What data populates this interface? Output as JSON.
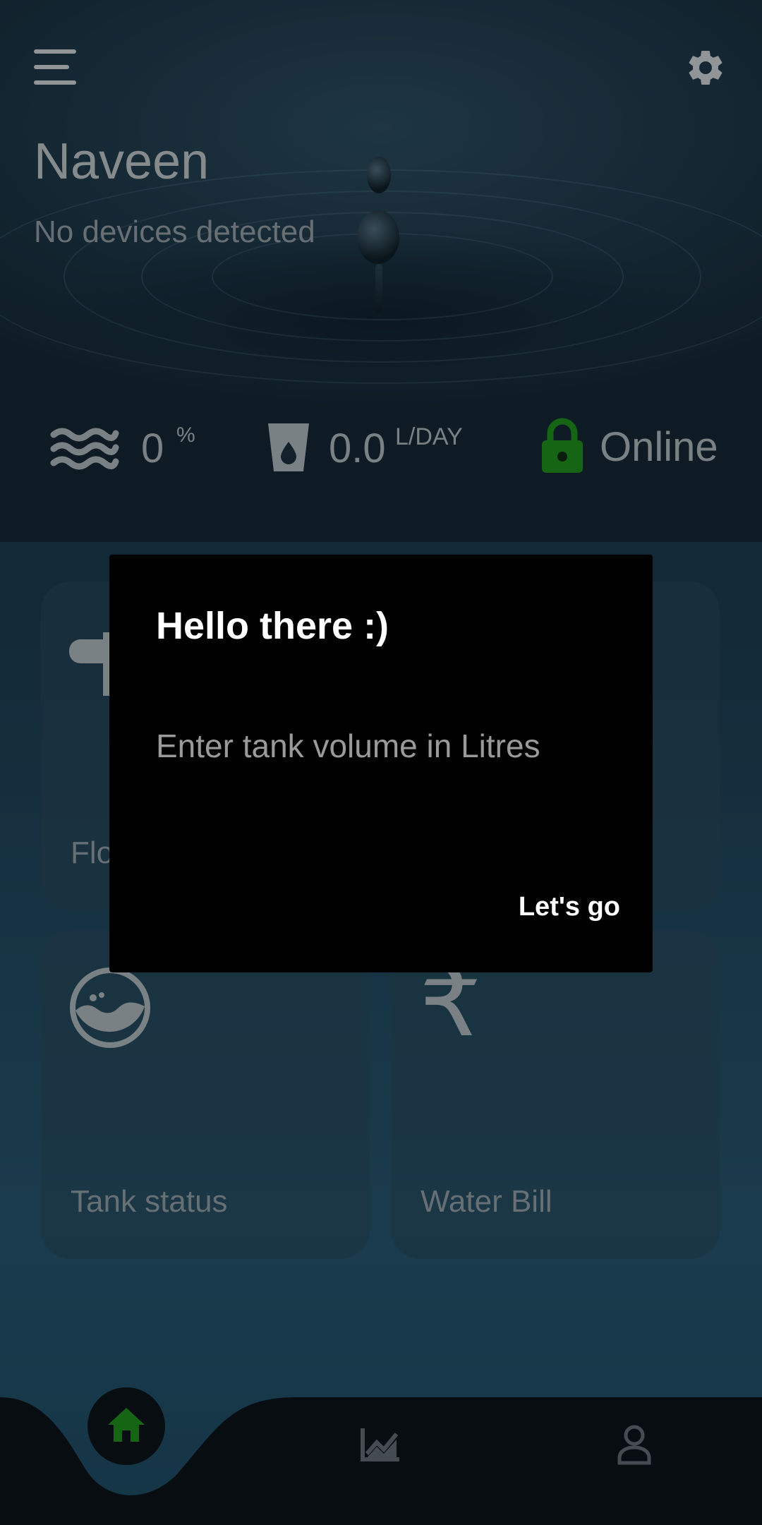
{
  "header": {
    "user_name": "Naveen",
    "device_status": "No devices detected"
  },
  "stats": {
    "level_value": "0",
    "level_unit": "%",
    "usage_value": "0.0",
    "usage_unit": "L/DAY",
    "connection_label": "Online",
    "connection_color": "#1e8c1e"
  },
  "cards": [
    {
      "label": "Flo",
      "icon": "faucet-icon"
    },
    {
      "label": "Tank status",
      "icon": "tank-icon"
    },
    {
      "label": "Water Bill",
      "icon": "rupee-icon"
    }
  ],
  "dialog": {
    "title": "Hello there :)",
    "input_placeholder": "Enter tank volume in Litres",
    "input_value": "",
    "confirm_label": "Let's go"
  },
  "nav": {
    "items": [
      {
        "name": "home",
        "icon": "home-icon",
        "active": true
      },
      {
        "name": "analytics",
        "icon": "chart-icon",
        "active": false
      },
      {
        "name": "profile",
        "icon": "user-icon",
        "active": false
      }
    ],
    "active_color": "#1e8c1e"
  },
  "icons": {
    "rupee_symbol": "₹"
  }
}
